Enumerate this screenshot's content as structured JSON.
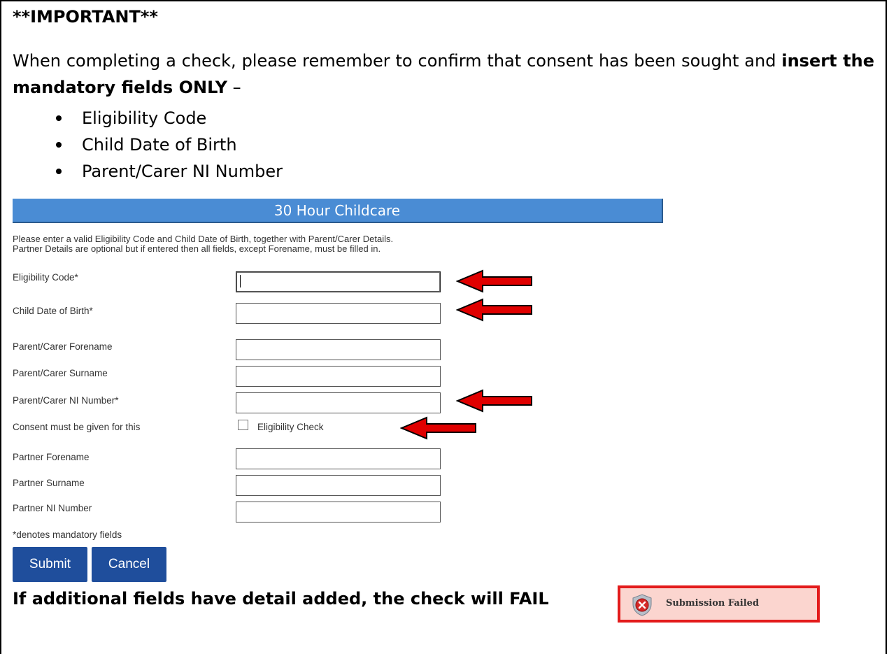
{
  "heading": "**IMPORTANT**",
  "intro": {
    "text": "When completing a check, please remember to confirm that consent has been sought and ",
    "bold": "insert the mandatory fields ONLY",
    "tail": " –"
  },
  "mandatory_list": [
    "Eligibility Code",
    "Child Date of Birth",
    "Parent/Carer NI Number"
  ],
  "form": {
    "title": "30 Hour Childcare",
    "info_line1": "Please enter a valid Eligibility Code and Child Date of Birth, together with Parent/Carer Details.",
    "info_line2": "Partner Details are optional but if entered then all fields, except Forename, must be filled in.",
    "fields": {
      "eligibility_code": {
        "label": "Eligibility Code*",
        "value": ""
      },
      "child_dob": {
        "label": "Child Date of Birth*",
        "value": ""
      },
      "parent_forename": {
        "label": "Parent/Carer Forename",
        "value": ""
      },
      "parent_surname": {
        "label": "Parent/Carer Surname",
        "value": ""
      },
      "parent_ni": {
        "label": "Parent/Carer NI Number*",
        "value": ""
      },
      "consent": {
        "label": "Consent must be given for this",
        "checkbox_label": "Eligibility Check",
        "checked": false
      },
      "partner_forename": {
        "label": "Partner Forename",
        "value": ""
      },
      "partner_surname": {
        "label": "Partner Surname",
        "value": ""
      },
      "partner_ni": {
        "label": "Partner NI Number",
        "value": ""
      }
    },
    "mandatory_note": "*denotes mandatory fields",
    "submit_label": "Submit",
    "cancel_label": "Cancel"
  },
  "footer_warning": "If additional fields have detail added, the check will FAIL",
  "toast": {
    "text": "Submission Failed",
    "icon": "error-shield-icon"
  },
  "colors": {
    "banner": "#4a8cd4",
    "button": "#1f4e9c",
    "arrow": "#e00000",
    "toast_bg": "#fbd5cf",
    "toast_border": "#e31b1b"
  }
}
